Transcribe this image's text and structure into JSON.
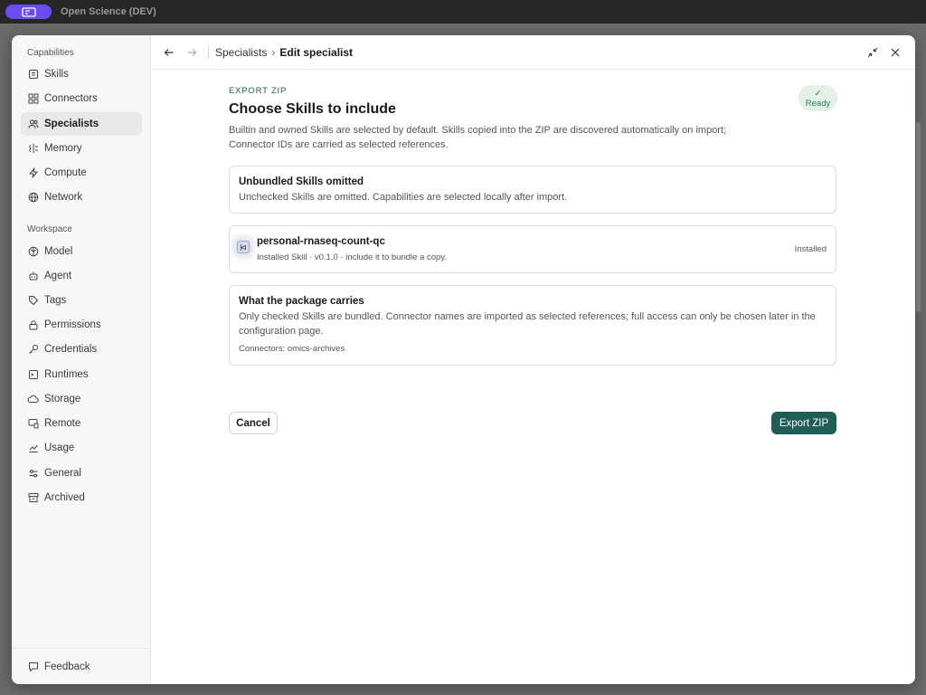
{
  "titlebar": {
    "app_title": "Open Science (DEV)"
  },
  "sidebar": {
    "capabilities_label": "Capabilities",
    "workspace_label": "Workspace",
    "capabilities": [
      {
        "label": "Skills",
        "icon": "skills-icon"
      },
      {
        "label": "Connectors",
        "icon": "connectors-icon"
      },
      {
        "label": "Specialists",
        "icon": "specialists-icon",
        "active": true
      },
      {
        "label": "Memory",
        "icon": "memory-icon"
      },
      {
        "label": "Compute",
        "icon": "compute-icon"
      },
      {
        "label": "Network",
        "icon": "network-icon"
      }
    ],
    "workspace": [
      {
        "label": "Model",
        "icon": "model-icon"
      },
      {
        "label": "Agent",
        "icon": "agent-icon"
      },
      {
        "label": "Tags",
        "icon": "tags-icon"
      },
      {
        "label": "Permissions",
        "icon": "lock-icon"
      },
      {
        "label": "Credentials",
        "icon": "key-icon"
      },
      {
        "label": "Runtimes",
        "icon": "terminal-icon"
      },
      {
        "label": "Storage",
        "icon": "cloud-icon"
      },
      {
        "label": "Remote",
        "icon": "remote-icon"
      },
      {
        "label": "Usage",
        "icon": "chart-icon"
      },
      {
        "label": "General",
        "icon": "sliders-icon"
      },
      {
        "label": "Archived",
        "icon": "archive-icon"
      }
    ],
    "feedback": "Feedback"
  },
  "header": {
    "breadcrumb_parent": "Specialists",
    "breadcrumb_sep": "›",
    "breadcrumb_current": "Edit specialist"
  },
  "main": {
    "eyebrow": "EXPORT ZIP",
    "heading": "Choose Skills to include",
    "description": "Builtin and owned Skills are selected by default. Skills copied into the ZIP are discovered automatically on import; Connector IDs are carried as selected references.",
    "status_check": "✓",
    "status_label": "Ready",
    "omitted_card": {
      "title": "Unbundled Skills omitted",
      "text": "Unchecked Skills are omitted. Capabilities are selected locally after import."
    },
    "skill_card": {
      "name": "personal-rnaseq-count-qc",
      "meta": "Installed Skill · v0.1.0 · include it to bundle a copy.",
      "status": "Installed"
    },
    "package_card": {
      "title": "What the package carries",
      "text": "Only checked Skills are bundled. Connector names are imported as selected references; full access can only be chosen later in the configuration page.",
      "connectors": "Connectors: omics-archives"
    },
    "cancel_label": "Cancel",
    "export_label": "Export ZIP"
  },
  "colors": {
    "accent": "#1f5e55",
    "app_pill": "#6a4cf0",
    "ready_bg": "#e4f0e8"
  }
}
